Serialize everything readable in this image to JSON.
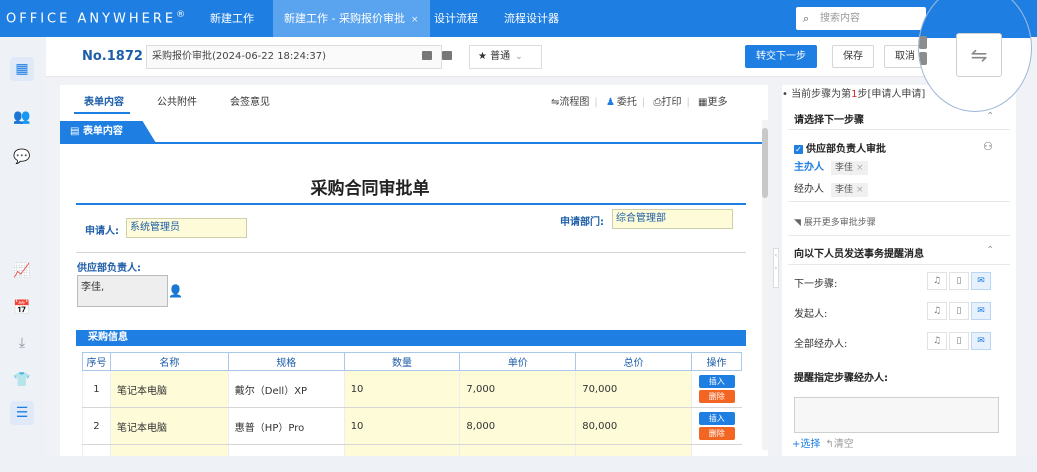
{
  "brand": {
    "logo_text": "Office Anywhere",
    "logo_mark": "®"
  },
  "top_tabs": [
    {
      "label": "新建工作",
      "active": false
    },
    {
      "label": "新建工作 - 采购报价审批",
      "active": true,
      "close": "×"
    },
    {
      "label": "设计流程",
      "active": false
    },
    {
      "label": "流程设计器",
      "active": false
    }
  ],
  "search": {
    "placeholder": "搜索内容"
  },
  "doc": {
    "number": "No.1872",
    "title": "采购报价审批(2024-06-22 18:24:37)",
    "priority": "普通",
    "btn_submit": "转交下一步",
    "btn_save": "保存",
    "btn_cancel": "取消"
  },
  "form_tabs": [
    {
      "label": "表单内容",
      "active": true
    },
    {
      "label": "公共附件",
      "active": false
    },
    {
      "label": "会签意见",
      "active": false
    }
  ],
  "tools": {
    "flowchart": "流程图",
    "delegate": "委托",
    "print": "打印",
    "more": "更多"
  },
  "form": {
    "section_tab": "表单内容",
    "title": "采购合同审批单",
    "applicant_label": "申请人:",
    "applicant_value": "系统管理员",
    "dept_label": "申请部门:",
    "dept_value": "综合管理部",
    "supplier_owner_label": "供应部负责人:",
    "supplier_owner_value": "李佳,",
    "purchase_section": "采购信息",
    "columns": [
      "序号",
      "名称",
      "规格",
      "数量",
      "单价",
      "总价",
      "操作"
    ],
    "rows": [
      {
        "no": "1",
        "name": "笔记本电脑",
        "spec": "戴尔（Dell）XP",
        "qty": "10",
        "price": "7,000",
        "total": "70,000"
      },
      {
        "no": "2",
        "name": "笔记本电脑",
        "spec": "惠普（HP）Pro",
        "qty": "10",
        "price": "8,000",
        "total": "80,000"
      }
    ],
    "btn_insert": "插入",
    "btn_delete": "删除"
  },
  "right": {
    "current_step_pre": "当前步骤为第",
    "current_step_num": "1",
    "current_step_post": "步[申请人申请]",
    "select_next_title": "请选择下一步骤",
    "step_option": "供应部负责人审批",
    "host_label": "主办人",
    "host_value": "李佳",
    "handler_label": "经办人",
    "handler_value": "李佳",
    "expand_more": "展开更多审批步骤",
    "notify_title": "向以下人员发送事务提醒消息",
    "notify_rows": [
      "下一步骤:",
      "发起人:",
      "全部经办人:"
    ],
    "remind_title": "提醒指定步骤经办人:",
    "select_link": "选择",
    "clear_link": "清空"
  },
  "colors": {
    "primary": "#1e7ee2",
    "danger": "#f26522",
    "field_yellow": "#fdfbd8"
  }
}
